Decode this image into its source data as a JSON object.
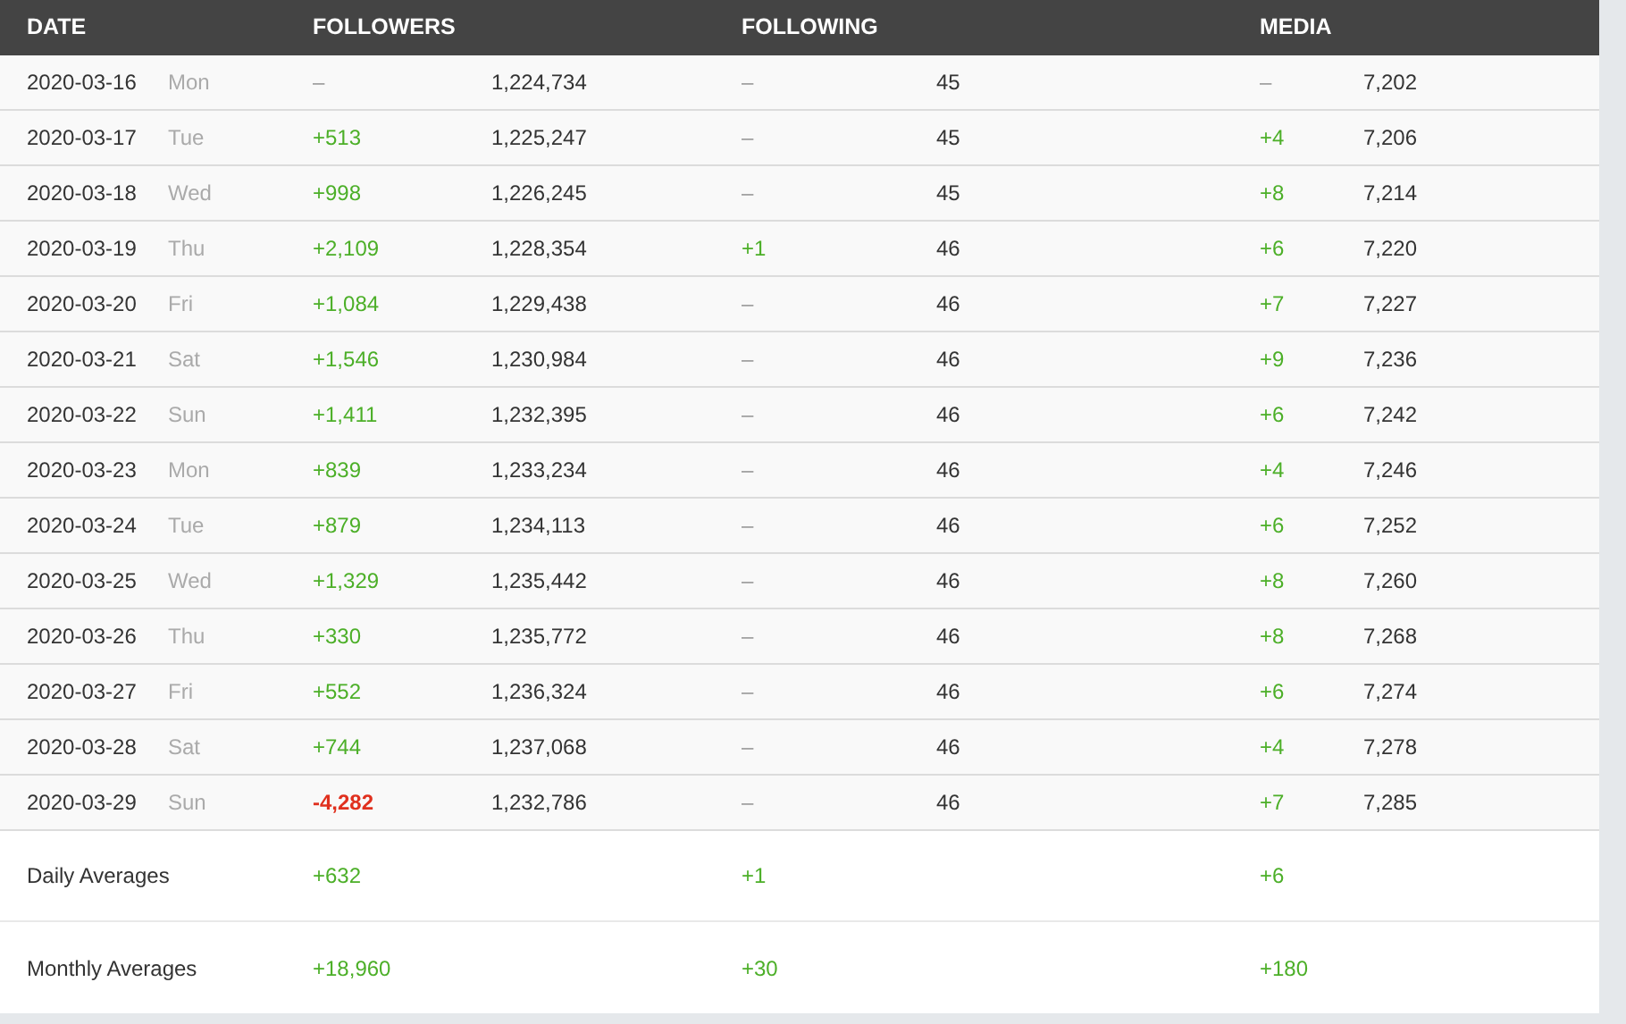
{
  "columns": [
    "DATE",
    "FOLLOWERS",
    "FOLLOWING",
    "MEDIA"
  ],
  "rows": [
    {
      "date": "2020-03-16",
      "day": "Mon",
      "followers_change": {
        "text": "–",
        "kind": "none"
      },
      "followers": "1,224,734",
      "following_change": {
        "text": "–",
        "kind": "none"
      },
      "following": "45",
      "media_change": {
        "text": "–",
        "kind": "none"
      },
      "media": "7,202"
    },
    {
      "date": "2020-03-17",
      "day": "Tue",
      "followers_change": {
        "text": "+513",
        "kind": "gain"
      },
      "followers": "1,225,247",
      "following_change": {
        "text": "–",
        "kind": "none"
      },
      "following": "45",
      "media_change": {
        "text": "+4",
        "kind": "gain"
      },
      "media": "7,206"
    },
    {
      "date": "2020-03-18",
      "day": "Wed",
      "followers_change": {
        "text": "+998",
        "kind": "gain"
      },
      "followers": "1,226,245",
      "following_change": {
        "text": "–",
        "kind": "none"
      },
      "following": "45",
      "media_change": {
        "text": "+8",
        "kind": "gain"
      },
      "media": "7,214"
    },
    {
      "date": "2020-03-19",
      "day": "Thu",
      "followers_change": {
        "text": "+2,109",
        "kind": "gain"
      },
      "followers": "1,228,354",
      "following_change": {
        "text": "+1",
        "kind": "gain"
      },
      "following": "46",
      "media_change": {
        "text": "+6",
        "kind": "gain"
      },
      "media": "7,220"
    },
    {
      "date": "2020-03-20",
      "day": "Fri",
      "followers_change": {
        "text": "+1,084",
        "kind": "gain"
      },
      "followers": "1,229,438",
      "following_change": {
        "text": "–",
        "kind": "none"
      },
      "following": "46",
      "media_change": {
        "text": "+7",
        "kind": "gain"
      },
      "media": "7,227"
    },
    {
      "date": "2020-03-21",
      "day": "Sat",
      "followers_change": {
        "text": "+1,546",
        "kind": "gain"
      },
      "followers": "1,230,984",
      "following_change": {
        "text": "–",
        "kind": "none"
      },
      "following": "46",
      "media_change": {
        "text": "+9",
        "kind": "gain"
      },
      "media": "7,236"
    },
    {
      "date": "2020-03-22",
      "day": "Sun",
      "followers_change": {
        "text": "+1,411",
        "kind": "gain"
      },
      "followers": "1,232,395",
      "following_change": {
        "text": "–",
        "kind": "none"
      },
      "following": "46",
      "media_change": {
        "text": "+6",
        "kind": "gain"
      },
      "media": "7,242"
    },
    {
      "date": "2020-03-23",
      "day": "Mon",
      "followers_change": {
        "text": "+839",
        "kind": "gain"
      },
      "followers": "1,233,234",
      "following_change": {
        "text": "–",
        "kind": "none"
      },
      "following": "46",
      "media_change": {
        "text": "+4",
        "kind": "gain"
      },
      "media": "7,246"
    },
    {
      "date": "2020-03-24",
      "day": "Tue",
      "followers_change": {
        "text": "+879",
        "kind": "gain"
      },
      "followers": "1,234,113",
      "following_change": {
        "text": "–",
        "kind": "none"
      },
      "following": "46",
      "media_change": {
        "text": "+6",
        "kind": "gain"
      },
      "media": "7,252"
    },
    {
      "date": "2020-03-25",
      "day": "Wed",
      "followers_change": {
        "text": "+1,329",
        "kind": "gain"
      },
      "followers": "1,235,442",
      "following_change": {
        "text": "–",
        "kind": "none"
      },
      "following": "46",
      "media_change": {
        "text": "+8",
        "kind": "gain"
      },
      "media": "7,260"
    },
    {
      "date": "2020-03-26",
      "day": "Thu",
      "followers_change": {
        "text": "+330",
        "kind": "gain"
      },
      "followers": "1,235,772",
      "following_change": {
        "text": "–",
        "kind": "none"
      },
      "following": "46",
      "media_change": {
        "text": "+8",
        "kind": "gain"
      },
      "media": "7,268"
    },
    {
      "date": "2020-03-27",
      "day": "Fri",
      "followers_change": {
        "text": "+552",
        "kind": "gain"
      },
      "followers": "1,236,324",
      "following_change": {
        "text": "–",
        "kind": "none"
      },
      "following": "46",
      "media_change": {
        "text": "+6",
        "kind": "gain"
      },
      "media": "7,274"
    },
    {
      "date": "2020-03-28",
      "day": "Sat",
      "followers_change": {
        "text": "+744",
        "kind": "gain"
      },
      "followers": "1,237,068",
      "following_change": {
        "text": "–",
        "kind": "none"
      },
      "following": "46",
      "media_change": {
        "text": "+4",
        "kind": "gain"
      },
      "media": "7,278"
    },
    {
      "date": "2020-03-29",
      "day": "Sun",
      "followers_change": {
        "text": "-4,282",
        "kind": "loss"
      },
      "followers": "1,232,786",
      "following_change": {
        "text": "–",
        "kind": "none"
      },
      "following": "46",
      "media_change": {
        "text": "+7",
        "kind": "gain"
      },
      "media": "7,285"
    }
  ],
  "averages": [
    {
      "label": "Daily Averages",
      "followers": "+632",
      "following": "+1",
      "media": "+6"
    },
    {
      "label": "Monthly Averages",
      "followers": "+18,960",
      "following": "+30",
      "media": "+180"
    }
  ]
}
